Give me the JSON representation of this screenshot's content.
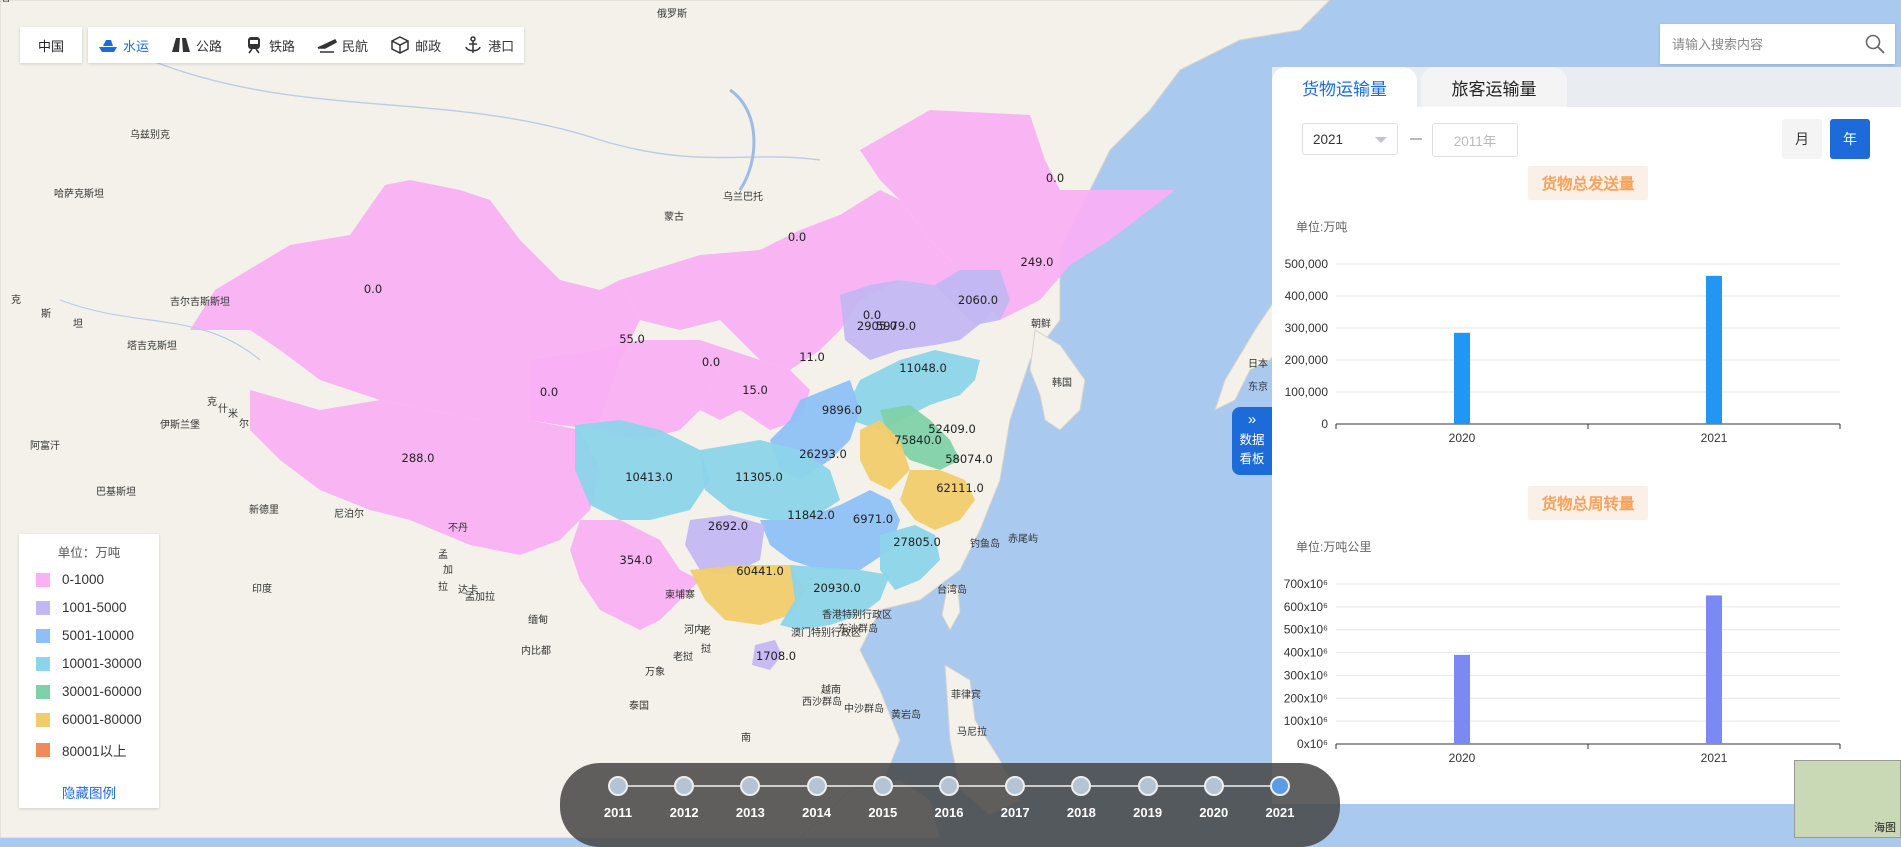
{
  "nav": {
    "region": "中国",
    "modes": [
      {
        "label": "水运",
        "icon": "ship-icon",
        "active": true
      },
      {
        "label": "公路",
        "icon": "road-icon",
        "active": false
      },
      {
        "label": "铁路",
        "icon": "train-icon",
        "active": false
      },
      {
        "label": "民航",
        "icon": "plane-icon",
        "active": false
      },
      {
        "label": "邮政",
        "icon": "package-icon",
        "active": false
      },
      {
        "label": "港口",
        "icon": "anchor-icon",
        "active": false
      }
    ]
  },
  "search": {
    "placeholder": "请输入搜索内容"
  },
  "legend": {
    "unit": "单位：万吨",
    "items": [
      {
        "label": "0-1000",
        "color": "#f9b0f4"
      },
      {
        "label": "1001-5000",
        "color": "#c3b7f2"
      },
      {
        "label": "5001-10000",
        "color": "#8ec0f7"
      },
      {
        "label": "10001-30000",
        "color": "#8cd4ea"
      },
      {
        "label": "30001-60000",
        "color": "#7fd1a9"
      },
      {
        "label": "60001-80000",
        "color": "#f0cc6c"
      },
      {
        "label": "80001以上",
        "color": "#ee8a5c"
      }
    ],
    "toggle": "隐藏图例"
  },
  "map": {
    "values": [
      "0.0",
      "0.0",
      "249.0",
      "0.0",
      "2060.0",
      "0.0",
      "2905.0",
      "5979.0",
      "55.0",
      "0.0",
      "11.0",
      "11048.0",
      "0.0",
      "15.0",
      "9896.0",
      "52409.0",
      "75840.0",
      "58074.0",
      "288.0",
      "26293.0",
      "10413.0",
      "11305.0",
      "62111.0",
      "11842.0",
      "6971.0",
      "2692.0",
      "27805.0",
      "354.0",
      "60441.0",
      "20930.0",
      "1708.0"
    ],
    "places": [
      "俄罗斯",
      "蒙古",
      "乌兰巴托",
      "哈萨克斯坦",
      "吉尔吉斯斯坦",
      "塔吉克斯坦",
      "阿富汗",
      "巴基斯坦",
      "印度",
      "尼泊尔",
      "不丹",
      "孟加拉",
      "缅甸",
      "老挝",
      "越南",
      "泰国",
      "柬埔寨",
      "南",
      "菲律宾",
      "朝鲜",
      "韩国",
      "日本",
      "东京",
      "香港特别行政区",
      "澳门特别行政区",
      "东沙群岛",
      "西沙群岛",
      "中沙群岛",
      "黄岩岛",
      "钓鱼岛",
      "赤尾屿",
      "台湾岛",
      "克",
      "斯",
      "坦",
      "克",
      "什",
      "米",
      "尔",
      "孟",
      "加",
      "拉",
      "老",
      "挝",
      "乌兹别克",
      "伊斯兰堡",
      "新德里",
      "达卡",
      "内比都",
      "河内",
      "万象",
      "曼谷",
      "马尼拉"
    ]
  },
  "panel": {
    "tabs": [
      {
        "label": "货物运输量",
        "active": true
      },
      {
        "label": "旅客运输量",
        "active": false
      }
    ],
    "year_start": "2021",
    "year_end_placeholder": "2011年",
    "period_month": "月",
    "period_year": "年",
    "side_toggle": [
      "数据",
      "看板"
    ]
  },
  "chart_data": [
    {
      "type": "bar",
      "title": "货物总发送量",
      "unit": "单位:万吨",
      "categories": [
        "2020",
        "2021"
      ],
      "values": [
        285000,
        463000
      ],
      "ylim": [
        0,
        500000
      ],
      "yticks": [
        "0",
        "100,000",
        "200,000",
        "300,000",
        "400,000",
        "500,000"
      ],
      "color": "#2196f3",
      "grid": true
    },
    {
      "type": "bar",
      "title": "货物总周转量",
      "unit": "单位:万吨公里",
      "categories": [
        "2020",
        "2021"
      ],
      "values": [
        390,
        650
      ],
      "ylim": [
        0,
        700
      ],
      "yticks": [
        "0x10⁶",
        "100x10⁶",
        "200x10⁶",
        "300x10⁶",
        "400x10⁶",
        "500x10⁶",
        "600x10⁶",
        "700x10⁶"
      ],
      "color": "#7b89f2",
      "grid": true
    }
  ],
  "timeline": {
    "years": [
      "2011",
      "2012",
      "2013",
      "2014",
      "2015",
      "2016",
      "2017",
      "2018",
      "2019",
      "2020",
      "2021"
    ],
    "active": "2021"
  },
  "minimap": {
    "label": "海图"
  }
}
